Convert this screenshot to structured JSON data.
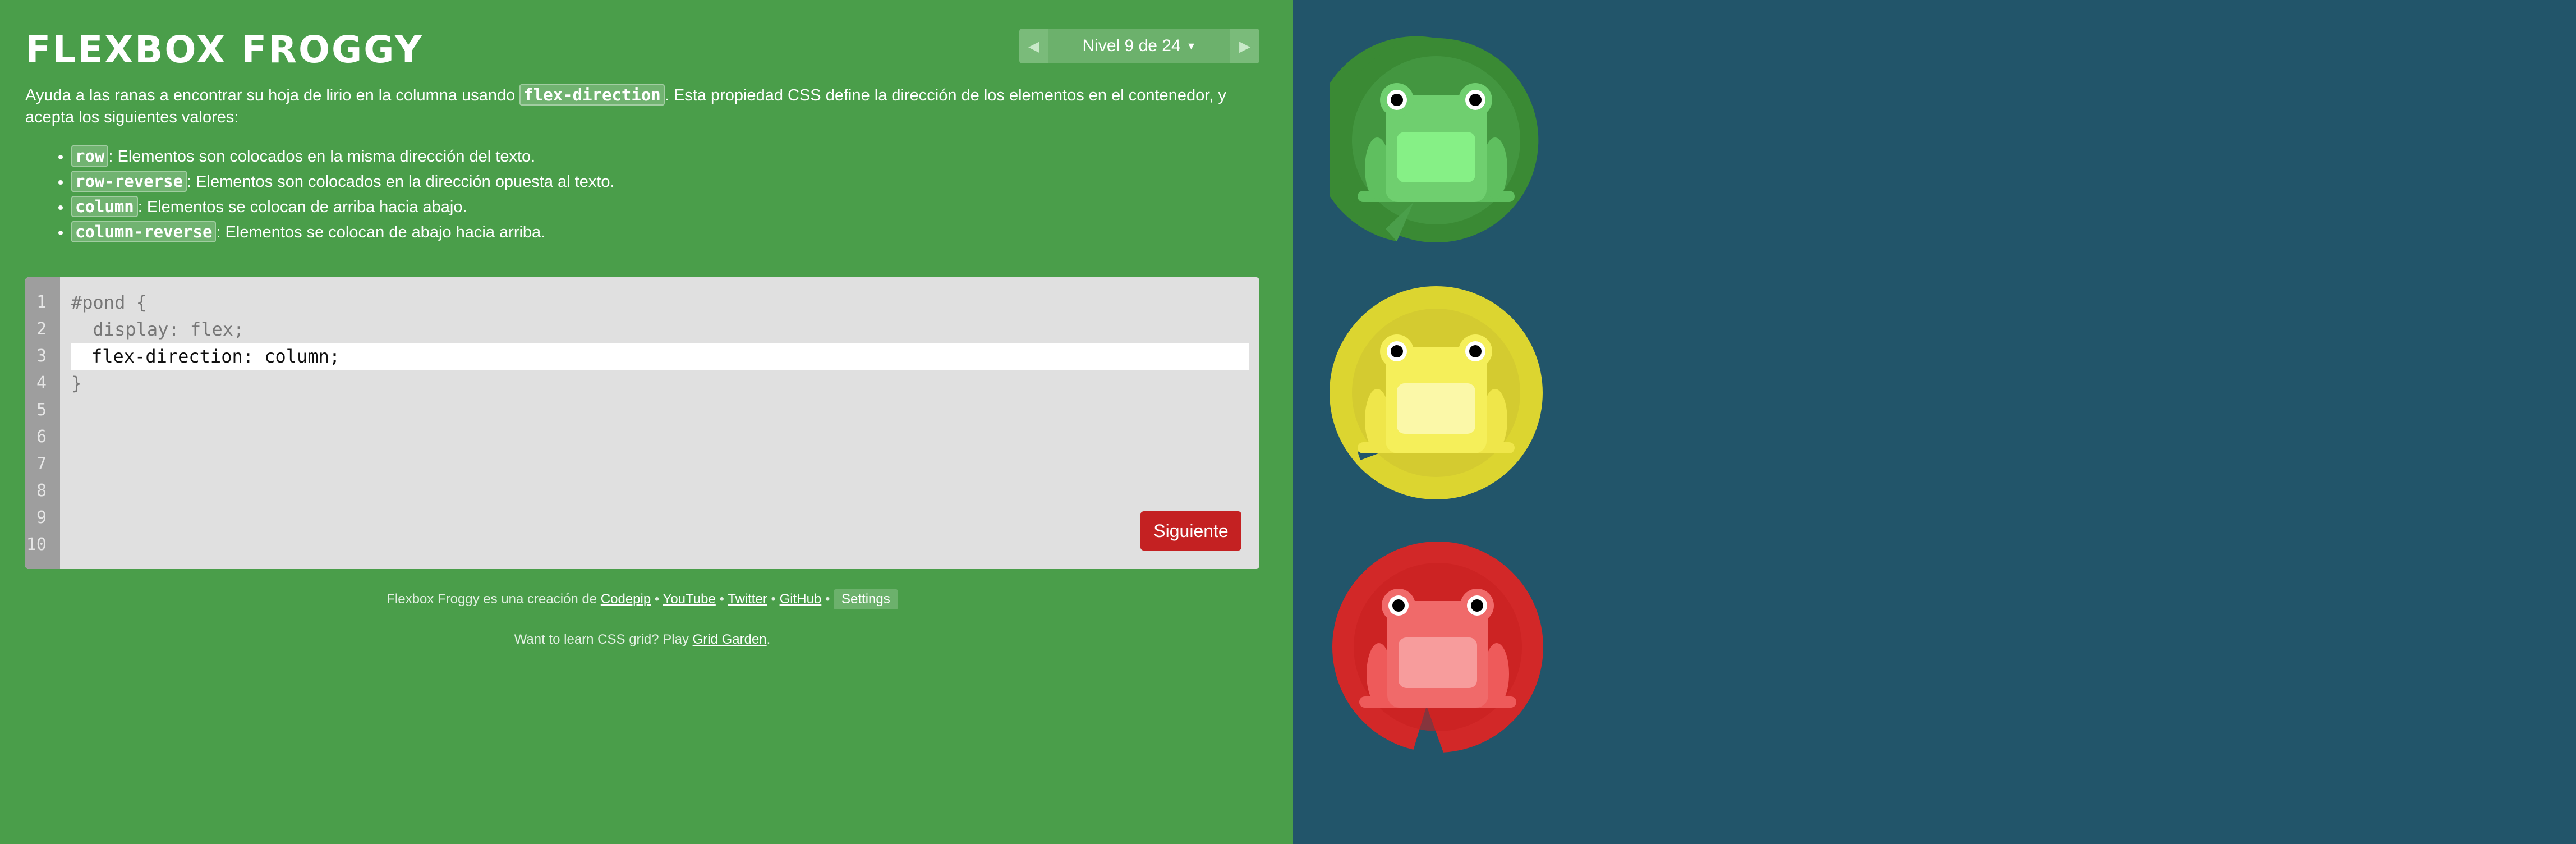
{
  "header": {
    "title": "FLEXBOX FROGGY",
    "level_label": "Nivel 9 de 24",
    "prev_icon": "triangle-left",
    "next_icon": "triangle-right",
    "caret_icon": "chevron-down"
  },
  "instructions": {
    "text_before": "Ayuda a las ranas a encontrar su hoja de lirio en la columna usando ",
    "property": "flex-direction",
    "text_after": ". Esta propiedad CSS define la dirección de los elementos en el contenedor, y acepta los siguientes valores:",
    "values": [
      {
        "code": "row",
        "desc": ": Elementos son colocados en la misma dirección del texto."
      },
      {
        "code": "row-reverse",
        "desc": ": Elementos son colocados en la dirección opuesta al texto."
      },
      {
        "code": "column",
        "desc": ": Elementos se colocan de arriba hacia abajo."
      },
      {
        "code": "column-reverse",
        "desc": ": Elementos se colocan de abajo hacia arriba."
      }
    ]
  },
  "editor": {
    "line_numbers": [
      "1",
      "2",
      "3",
      "4",
      "5",
      "6",
      "7",
      "8",
      "9",
      "10"
    ],
    "line1": "#pond {",
    "line2": "  display: flex;",
    "input_value": "flex-direction: column;",
    "line4": "}",
    "next_label": "Siguiente"
  },
  "footer": {
    "credit_text": "Flexbox Froggy es una creación de ",
    "codepip": "Codepip",
    "youtube": "YouTube",
    "twitter": "Twitter",
    "github": "GitHub",
    "sep": " • ",
    "settings": "Settings",
    "cta_text": "Want to learn CSS grid? Play ",
    "cta_link": "Grid Garden",
    "cta_end": "."
  },
  "colors": {
    "sidebar_bg": "#4a9e4a",
    "pond_bg": "#22556a",
    "green_pad": "#3a8a34",
    "yellow_pad": "#dcd530",
    "red_pad": "#d22828",
    "next_button": "#c42122"
  },
  "board": {
    "frogs": [
      {
        "color": "green"
      },
      {
        "color": "yellow"
      },
      {
        "color": "red"
      }
    ]
  }
}
